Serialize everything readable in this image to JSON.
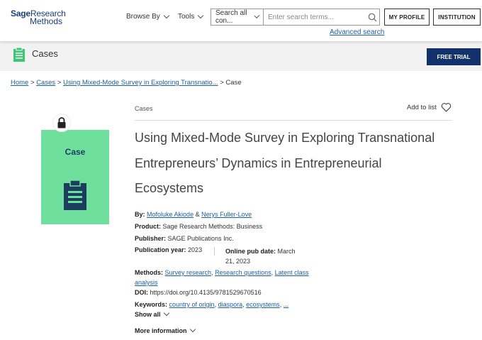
{
  "header": {
    "logo_sage": "Sage",
    "logo_research": "Research",
    "logo_methods": "Methods",
    "nav": [
      "Browse By",
      "Tools"
    ],
    "search": {
      "scope": "Search all con...",
      "placeholder": "Enter search terms..."
    },
    "advanced_search": "Advanced search",
    "my_profile": "MY PROFILE",
    "institution": "INSTITUTION"
  },
  "section": {
    "title": "Cases",
    "free_trial": "FREE TRIAL"
  },
  "breadcrumb": {
    "home": "Home",
    "sep": ">",
    "cases": "Cases",
    "article": "Using Mixed-Mode Survey in Exploring Transnatio...",
    "current": "Case"
  },
  "cover": {
    "label": "Case"
  },
  "article": {
    "content_type": "Cases",
    "add_to_list": "Add to list",
    "title": "Using Mixed-Mode Survey in Exploring Transnational Entrepreneurs’ Dynamics in Entrepreneurial Ecosystems",
    "by_label": "By:",
    "authors": [
      "Mofoluke Akiode",
      "Nerys Fuller-Love"
    ],
    "amp": "&",
    "product_label": "Product:",
    "product": "Sage Research Methods: Business",
    "publisher_label": "Publisher:",
    "publisher": "SAGE Publications Inc.",
    "pub_year_label": "Publication year:",
    "pub_year": "2023",
    "online_pub_label": "Online pub date:",
    "online_pub_line1": "March",
    "online_pub_line2": "21, 2023",
    "methods_label": "Methods:",
    "methods": [
      "Survey research",
      "Research questions",
      "Latent class",
      "analysis"
    ],
    "comma": ",",
    "doi_label": "DOI:",
    "doi": "https://doi.org/10.4135/9781529670516",
    "keywords_label": "Keywords:",
    "keywords": [
      "country of origin",
      "diaspora",
      "ecosystems",
      "..."
    ],
    "show_all": "Show all",
    "more_info": "More information"
  },
  "colors": {
    "brand_navy": "#13326b",
    "link_blue": "#1f5fa6",
    "case_green": "#6edf9d",
    "icon_green": "#3cc774"
  }
}
